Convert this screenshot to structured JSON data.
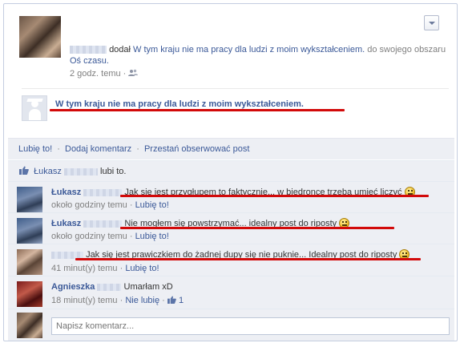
{
  "post": {
    "verb": "dodał",
    "link_title": "W tym kraju nie ma pracy dla ludzi z moim wykształceniem.",
    "rest": " do swojego obszaru",
    "area_link": "Oś czasu.",
    "time": "2 godz. temu",
    "dot": "·",
    "privacy_icon": "friends-icon"
  },
  "shared": {
    "title": "W tym kraju nie ma pracy dla ludzi z moim wykształceniem."
  },
  "actions": {
    "like": "Lubię to!",
    "comment": "Dodaj komentarz",
    "unfollow": "Przestań obserwować post",
    "dot": "·"
  },
  "likes": {
    "name": "Łukasz",
    "suffix": "lubi to.",
    "icon": "thumbs-up-icon"
  },
  "comments": [
    {
      "author": "Łukasz",
      "text": "Jak się jest przygłupem to faktycznie... w biedronce trzeba umieć liczyć",
      "time": "około godziny temu",
      "action": "Lubię to!"
    },
    {
      "author": "Łukasz",
      "text": "Nie mogłem się powstrzymać... idealny post do riposty",
      "time": "około godziny temu",
      "action": "Lubię to!"
    },
    {
      "author": "",
      "text": "Jak się jest prawiczkiem do żadnej dupy się nie puknie... Idealny post do riposty",
      "time": "41 minut(y) temu",
      "action": "Lubię to!"
    },
    {
      "author": "Agnieszka",
      "text": "Umarłam xD",
      "time": "18 minut(y) temu",
      "action": "Nie lubię",
      "likes": "1"
    }
  ],
  "composer": {
    "placeholder": "Napisz komentarz..."
  },
  "colors": {
    "link": "#3b5998",
    "panel": "#edeff4",
    "annotation": "#d20a0a"
  }
}
